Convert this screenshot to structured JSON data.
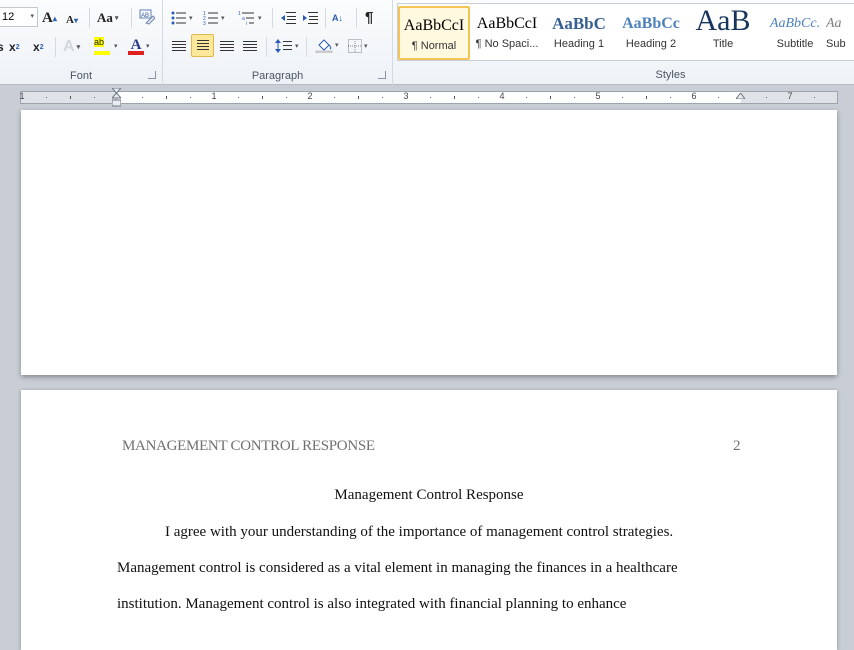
{
  "ribbon": {
    "font_group": {
      "label": "Font",
      "font_size": "12",
      "buttons": {
        "grow": "A",
        "shrink": "A",
        "change_case": "Aa",
        "subscript": "x",
        "superscript": "x",
        "text_effects": "A",
        "highlight": "ab",
        "font_color": "A"
      },
      "highlight_color": "#ffff00",
      "font_color": "#e02020"
    },
    "paragraph_group": {
      "label": "Paragraph",
      "pilcrow": "¶",
      "sort": "A↓",
      "active_alignment": "center"
    },
    "styles_group": {
      "label": "Styles",
      "items": [
        {
          "preview": "AaBbCcI",
          "name": "¶ Normal",
          "selected": true
        },
        {
          "preview": "AaBbCcI",
          "name": "¶ No Spaci..."
        },
        {
          "preview": "AaBbC",
          "name": "Heading 1"
        },
        {
          "preview": "AaBbCc",
          "name": "Heading 2"
        },
        {
          "preview": "AaB",
          "name": "Title"
        },
        {
          "preview": "AaBbCc.",
          "name": "Subtitle"
        },
        {
          "preview": "Aa",
          "name": "Sub"
        }
      ]
    }
  },
  "ruler": {
    "numbers": [
      "1",
      "1",
      "2",
      "3",
      "4",
      "5",
      "6",
      "7"
    ]
  },
  "document": {
    "header_text": "MANAGEMENT CONTROL RESPONSE",
    "page_number": "2",
    "title": "Management Control Response",
    "lines": [
      "I agree with your understanding of the importance of management control strategies.",
      "Management control is considered as a vital element in managing the finances in a healthcare",
      "institution. Management control is also integrated with financial planning to enhance"
    ]
  }
}
